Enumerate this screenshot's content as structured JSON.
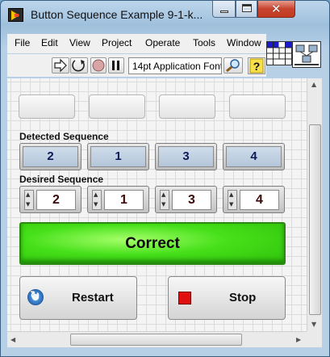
{
  "window": {
    "title": "Button Sequence Example 9-1-k...",
    "minimize_glyph": "",
    "maximize_glyph": "",
    "close_glyph": "✕"
  },
  "menu": [
    "File",
    "Edit",
    "View",
    "Project",
    "Operate",
    "Tools",
    "Window"
  ],
  "toolbar": {
    "run_icon": "run-arrow-icon",
    "run_continuous_icon": "run-continuously-icon",
    "abort_icon": "abort-icon",
    "pause_icon": "pause-icon",
    "font_select": "14pt Application Font",
    "search_icon": "search-icon",
    "help_icon": "help-icon"
  },
  "panel": {
    "sequence_buttons_count_visible": 4,
    "detected_label": "Detected Sequence",
    "detected_values": [
      "2",
      "1",
      "3",
      "4"
    ],
    "desired_label": "Desired Sequence",
    "desired_values": [
      "2",
      "1",
      "3",
      "4"
    ],
    "result_text": "Correct",
    "result_color": "#3fd612",
    "restart_label": "Restart",
    "stop_label": "Stop",
    "stop_icon_color": "#e01010"
  }
}
